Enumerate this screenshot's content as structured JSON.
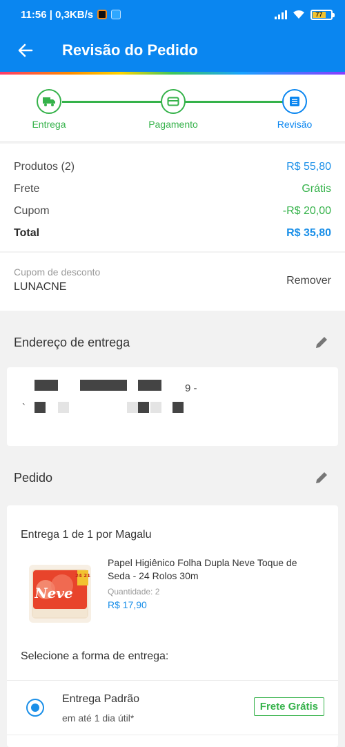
{
  "status_bar": {
    "time_speed": "11:56 | 0,3KB/s",
    "battery": "77"
  },
  "header": {
    "title": "Revisão do Pedido"
  },
  "stepper": {
    "steps": [
      {
        "label": "Entrega",
        "icon": "truck-icon"
      },
      {
        "label": "Pagamento",
        "icon": "card-icon"
      },
      {
        "label": "Revisão",
        "icon": "list-icon"
      }
    ]
  },
  "summary": {
    "products_label": "Produtos (2)",
    "products_value": "R$ 55,80",
    "shipping_label": "Frete",
    "shipping_value": "Grátis",
    "coupon_label": "Cupom",
    "coupon_value": "-R$ 20,00",
    "total_label": "Total",
    "total_value": "R$ 35,80"
  },
  "coupon": {
    "label": "Cupom de desconto",
    "code": "LUNACNE",
    "remove_label": "Remover"
  },
  "address": {
    "section_title": "Endereço de entrega",
    "line1_fragment": "9 -",
    "line2_fragment": "`"
  },
  "order": {
    "section_title": "Pedido",
    "delivery_title": "Entrega 1 de 1 por Magalu",
    "product": {
      "name": "Papel Higiênico Folha Dupla Neve Toque de Seda - 24 Rolos 30m",
      "quantity": "Quantidade:  2",
      "price": "R$ 17,90",
      "brand_text": "Neve",
      "pack_text": "24 21"
    },
    "select_label": "Selecione a forma de entrega:",
    "shipping_option": {
      "name": "Entrega Padrão",
      "eta": "em até 1 dia útil*",
      "badge": "Frete Grátis",
      "selected": true
    }
  },
  "colors": {
    "primary": "#0a86f0",
    "green": "#35b24a",
    "price_blue": "#1a8fe8"
  }
}
